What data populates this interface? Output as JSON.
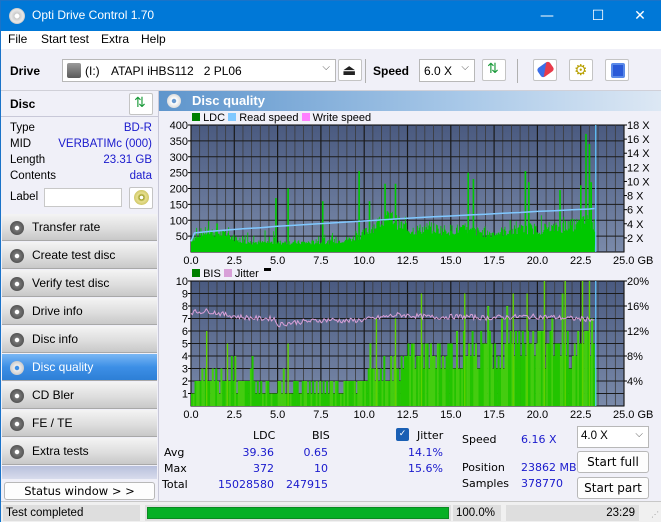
{
  "window": {
    "title": "Opti Drive Control 1.70",
    "controls": {
      "minimize": "—",
      "maximize": "☐",
      "close": "✕"
    }
  },
  "menu": [
    "File",
    "Start test",
    "Extra",
    "Help"
  ],
  "toolbar": {
    "drive_label": "Drive",
    "drive_letter": "(I:)",
    "drive_value": "ATAPI iHBS112   2 PL06",
    "speed_label": "Speed",
    "speed_value": "6.0 X",
    "icons": [
      "eject-icon",
      "refresh-icon",
      "erase-icon",
      "settings-icon",
      "save-icon"
    ]
  },
  "disc": {
    "header": "Disc",
    "fields": [
      {
        "key": "Type",
        "value": "BD-R"
      },
      {
        "key": "MID",
        "value": "VERBATIMc (000)"
      },
      {
        "key": "Length",
        "value": "23.31 GB"
      },
      {
        "key": "Contents",
        "value": "data"
      }
    ],
    "label_key": "Label",
    "label_value": ""
  },
  "nav": [
    {
      "label": "Transfer rate",
      "active": false
    },
    {
      "label": "Create test disc",
      "active": false
    },
    {
      "label": "Verify test disc",
      "active": false
    },
    {
      "label": "Drive info",
      "active": false
    },
    {
      "label": "Disc info",
      "active": false
    },
    {
      "label": "Disc quality",
      "active": true
    },
    {
      "label": "CD Bler",
      "active": false
    },
    {
      "label": "FE / TE",
      "active": false
    },
    {
      "label": "Extra tests",
      "active": false
    }
  ],
  "status_window_button": "Status window > >",
  "panel": {
    "title": "Disc quality"
  },
  "colors": {
    "ldc": "#008000",
    "read_speed": "#80c8ff",
    "write_speed": "#ff80ff",
    "bis": "#008000",
    "jitter": "#d8a0d8",
    "plot_bg_top": "#4a5a80",
    "plot_bg_bottom": "#7a8aaa",
    "bar_green": "#00c800",
    "bar_green2": "#40c800"
  },
  "chart_data": [
    {
      "type": "bar",
      "title": "LDC / Read speed",
      "legend": [
        "LDC",
        "Read speed",
        "Write speed"
      ],
      "legend_placement": "top-left",
      "xlabel": "GB",
      "x_ticks": [
        "0.0",
        "2.5",
        "5.0",
        "7.5",
        "10.0",
        "12.5",
        "15.0",
        "17.5",
        "20.0",
        "22.5",
        "25.0 GB"
      ],
      "xlim": [
        0,
        25
      ],
      "y_ticks": [
        "400",
        "350",
        "300",
        "250",
        "200",
        "150",
        "100",
        "50"
      ],
      "ylim": [
        0,
        400
      ],
      "y2_ticks": [
        "18 X",
        "16 X",
        "14 X",
        "12 X",
        "10 X",
        "8 X",
        "6 X",
        "4 X",
        "2 X"
      ],
      "y2lim": [
        0,
        18
      ],
      "data_end_gb": 23.31,
      "ldc_profile": {
        "x": [
          0,
          0.5,
          1,
          1.5,
          2,
          2.5,
          3,
          3.5,
          4,
          4.5,
          5,
          5.5,
          6,
          6.5,
          7,
          7.5,
          8,
          8.5,
          9,
          9.5,
          10,
          10.5,
          11,
          11.5,
          12,
          12.5,
          13,
          13.5,
          14,
          14.5,
          15,
          15.5,
          16,
          16.5,
          17,
          17.5,
          18,
          18.5,
          19,
          19.5,
          20,
          20.5,
          21,
          21.5,
          22,
          22.5,
          23,
          23.3
        ],
        "base": [
          40,
          60,
          65,
          60,
          55,
          45,
          35,
          30,
          30,
          30,
          30,
          30,
          30,
          30,
          30,
          30,
          32,
          35,
          40,
          45,
          60,
          80,
          100,
          110,
          90,
          70,
          70,
          75,
          75,
          70,
          70,
          72,
          65,
          65,
          60,
          60,
          65,
          68,
          70,
          75,
          72,
          75,
          75,
          80,
          85,
          90,
          100,
          80
        ]
      },
      "ldc_spikes": [
        {
          "x": 1.5,
          "y": 90
        },
        {
          "x": 4.9,
          "y": 170
        },
        {
          "x": 5.6,
          "y": 200
        },
        {
          "x": 7.6,
          "y": 160
        },
        {
          "x": 9.7,
          "y": 255
        },
        {
          "x": 10.3,
          "y": 160
        },
        {
          "x": 11.2,
          "y": 215
        },
        {
          "x": 11.8,
          "y": 215
        },
        {
          "x": 16.0,
          "y": 250
        },
        {
          "x": 16.3,
          "y": 230
        },
        {
          "x": 19.3,
          "y": 255
        },
        {
          "x": 19.5,
          "y": 220
        },
        {
          "x": 21.3,
          "y": 195
        },
        {
          "x": 22.5,
          "y": 210
        },
        {
          "x": 22.8,
          "y": 372
        },
        {
          "x": 23.0,
          "y": 340
        },
        {
          "x": 23.1,
          "y": 220
        }
      ],
      "read_speed": {
        "x": [
          0,
          0.2,
          1,
          2,
          3,
          4,
          5,
          6,
          7,
          8,
          9,
          10,
          11,
          12,
          13,
          14,
          15,
          16,
          17,
          18,
          19,
          20,
          21,
          22,
          23,
          23.3
        ],
        "y": [
          1.5,
          2.7,
          2.9,
          3.1,
          3.3,
          3.45,
          3.65,
          3.8,
          3.95,
          4.1,
          4.25,
          4.4,
          4.55,
          4.7,
          4.85,
          5.0,
          5.1,
          5.25,
          5.35,
          5.5,
          5.6,
          5.75,
          5.85,
          6.0,
          6.1,
          6.16
        ]
      }
    },
    {
      "type": "bar",
      "title": "BIS / Jitter",
      "legend": [
        "BIS",
        "Jitter"
      ],
      "legend_placement": "top-left",
      "xlabel": "GB",
      "x_ticks": [
        "0.0",
        "2.5",
        "5.0",
        "7.5",
        "10.0",
        "12.5",
        "15.0",
        "17.5",
        "20.0",
        "22.5",
        "25.0 GB"
      ],
      "xlim": [
        0,
        25
      ],
      "y_ticks": [
        "10",
        "9",
        "8",
        "7",
        "6",
        "5",
        "4",
        "3",
        "2",
        "1"
      ],
      "ylim": [
        0,
        10
      ],
      "y2_ticks": [
        "20%",
        "16%",
        "12%",
        "8%",
        "4%"
      ],
      "y2lim": [
        0,
        20
      ],
      "data_end_gb": 23.31,
      "bis_profile": {
        "x": [
          0,
          1,
          2,
          3,
          4,
          5,
          6,
          7,
          8,
          9,
          10,
          11,
          12,
          13,
          14,
          15,
          16,
          17,
          18,
          19,
          20,
          21,
          22,
          23,
          23.3
        ],
        "base": [
          2,
          3,
          2,
          2,
          2,
          2,
          2,
          2,
          2,
          2,
          3,
          4,
          4,
          5,
          5,
          5,
          5,
          5,
          5,
          6,
          6,
          6,
          6,
          6,
          5
        ]
      },
      "bis_spikes": [
        {
          "x": 0.9,
          "y": 6
        },
        {
          "x": 2.1,
          "y": 5
        },
        {
          "x": 5.6,
          "y": 5
        },
        {
          "x": 10.7,
          "y": 7
        },
        {
          "x": 11.8,
          "y": 7
        },
        {
          "x": 13.3,
          "y": 9
        },
        {
          "x": 15.8,
          "y": 9
        },
        {
          "x": 18.6,
          "y": 9
        },
        {
          "x": 19.4,
          "y": 9
        },
        {
          "x": 20.4,
          "y": 10
        },
        {
          "x": 21.6,
          "y": 10
        },
        {
          "x": 22.6,
          "y": 10
        },
        {
          "x": 23.0,
          "y": 10
        }
      ],
      "jitter": {
        "x": [
          0,
          1,
          2,
          3,
          4,
          4.8,
          5.0,
          6,
          7,
          8,
          9,
          10,
          11,
          12,
          13,
          14,
          15,
          16,
          17,
          18,
          19,
          20,
          21,
          22,
          23,
          23.3
        ],
        "y": [
          15.0,
          15.2,
          14.6,
          14.2,
          14.0,
          14.0,
          13.0,
          13.4,
          13.6,
          13.8,
          13.6,
          13.8,
          14.2,
          14.6,
          14.4,
          14.2,
          14.3,
          14.3,
          14.1,
          14.2,
          14.3,
          14.3,
          14.2,
          14.0,
          13.9,
          13.8
        ]
      }
    }
  ],
  "stats": {
    "col_ldc": "LDC",
    "col_bis": "BIS",
    "jitter_label": "Jitter",
    "jitter_checked": true,
    "rows": [
      {
        "label": "Avg",
        "ldc": "39.36",
        "bis": "0.65",
        "jitter": "14.1%"
      },
      {
        "label": "Max",
        "ldc": "372",
        "bis": "10",
        "jitter": "15.6%"
      },
      {
        "label": "Total",
        "ldc": "15028580",
        "bis": "247915",
        "jitter": ""
      }
    ],
    "speed_label": "Speed",
    "speed_value": "6.16 X",
    "position_label": "Position",
    "position_value": "23862 MB",
    "samples_label": "Samples",
    "samples_value": "378770",
    "test_speed": "4.0 X",
    "start_full": "Start full",
    "start_part": "Start part"
  },
  "statusbar": {
    "text": "Test completed",
    "progress": 100.0,
    "progress_text": "100.0%",
    "time": "23:29"
  }
}
